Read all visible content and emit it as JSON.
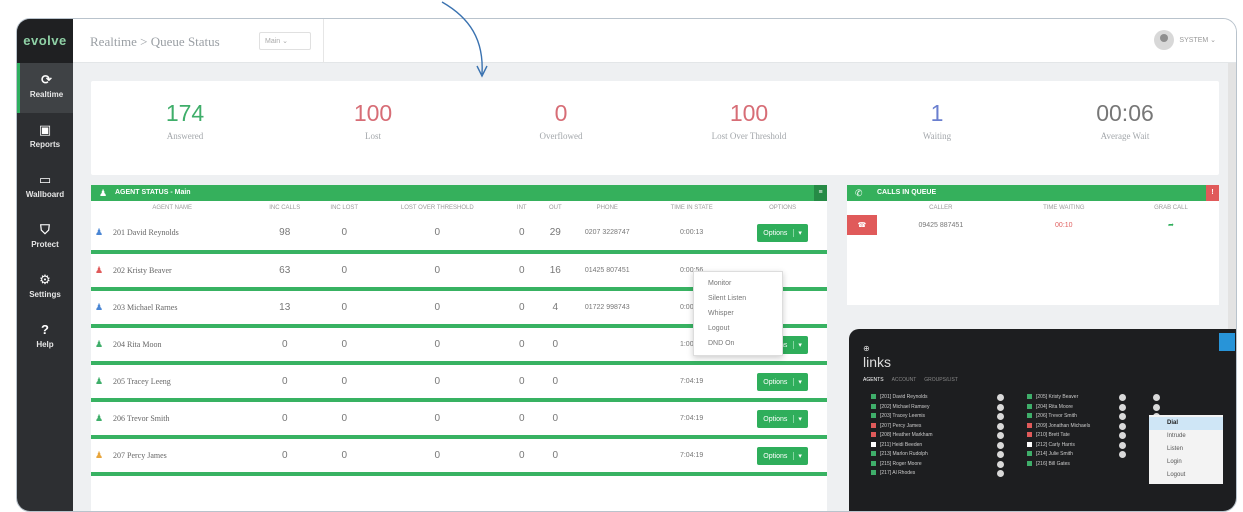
{
  "app": {
    "logo": "evolve",
    "breadcrumb": "Realtime > Queue Status",
    "queue_select": "Main ⌄",
    "user": "SYSTEM ⌄"
  },
  "sidebar": [
    {
      "label": "Realtime",
      "icon": "refresh-icon",
      "glyph": "⟳"
    },
    {
      "label": "Reports",
      "icon": "briefcase-icon",
      "glyph": "▣"
    },
    {
      "label": "Wallboard",
      "icon": "monitor-icon",
      "glyph": "▭"
    },
    {
      "label": "Protect",
      "icon": "shield-icon",
      "glyph": "⛉"
    },
    {
      "label": "Settings",
      "icon": "gears-icon",
      "glyph": "⚙"
    },
    {
      "label": "Help",
      "icon": "help-icon",
      "glyph": "?"
    }
  ],
  "stats": [
    {
      "value": "174",
      "label": "Answered",
      "color": "#3fae6a"
    },
    {
      "value": "100",
      "label": "Lost",
      "color": "#d76d76"
    },
    {
      "value": "0",
      "label": "Overflowed",
      "color": "#d76d76"
    },
    {
      "value": "100",
      "label": "Lost Over Threshold",
      "color": "#d76d76"
    },
    {
      "value": "1",
      "label": "Waiting",
      "color": "#6a7fcf"
    },
    {
      "value": "00:06",
      "label": "Average Wait",
      "color": "#777777"
    }
  ],
  "agents": {
    "title": "AGENT STATUS - Main",
    "columns": [
      "AGENT NAME",
      "INC CALLS",
      "INC LOST",
      "LOST OVER THRESHOLD",
      "INT",
      "OUT",
      "PHONE",
      "TIME IN STATE",
      "OPTIONS"
    ],
    "rows": [
      {
        "name": "201 David Reynolds",
        "inc": "98",
        "lost": "0",
        "lot": "0",
        "int": "0",
        "out": "29",
        "phone": "0207 3228747",
        "time": "0:00:13",
        "color": "#4a86d4",
        "options": true
      },
      {
        "name": "202 Kristy Beaver",
        "inc": "63",
        "lost": "0",
        "lot": "0",
        "int": "0",
        "out": "16",
        "phone": "01425 807451",
        "time": "0:00:56",
        "color": "#e05a5a",
        "options": false
      },
      {
        "name": "203 Michael Rarnes",
        "inc": "13",
        "lost": "0",
        "lot": "0",
        "int": "0",
        "out": "4",
        "phone": "01722 998743",
        "time": "0:00:02",
        "color": "#4a86d4",
        "options": false
      },
      {
        "name": "204 Rita Moon",
        "inc": "0",
        "lost": "0",
        "lot": "0",
        "int": "0",
        "out": "0",
        "phone": "",
        "time": "1:00:39",
        "color": "#3fae6a",
        "options": true
      },
      {
        "name": "205 Tracey Leeng",
        "inc": "0",
        "lost": "0",
        "lot": "0",
        "int": "0",
        "out": "0",
        "phone": "",
        "time": "7:04:19",
        "color": "#3fae6a",
        "options": true
      },
      {
        "name": "206 Trevor Smith",
        "inc": "0",
        "lost": "0",
        "lot": "0",
        "int": "0",
        "out": "0",
        "phone": "",
        "time": "7:04:19",
        "color": "#3fae6a",
        "options": true
      },
      {
        "name": "207 Percy James",
        "inc": "0",
        "lost": "0",
        "lot": "0",
        "int": "0",
        "out": "0",
        "phone": "",
        "time": "7:04:19",
        "color": "#e8a53c",
        "options": true
      }
    ],
    "options_label": "Options",
    "menu": [
      "Monitor",
      "Silent Listen",
      "Whisper",
      "Logout",
      "DND On"
    ]
  },
  "calls": {
    "title": "CALLS IN QUEUE",
    "columns": [
      "CALLER",
      "TIME WAITING",
      "GRAB CALL"
    ],
    "rows": [
      {
        "caller": "09425 887451",
        "waiting": "00:10"
      }
    ]
  },
  "links": {
    "title": "links",
    "tabs": [
      "AGENTS",
      "ACCOUNT",
      "GROUPS/LIST"
    ],
    "col1": [
      {
        "t": "[201] David Reynolds",
        "c": "#3fae6a"
      },
      {
        "t": "[202] Michael Ramsey",
        "c": "#3fae6a"
      },
      {
        "t": "[203] Tracey Leemis",
        "c": "#3fae6a"
      },
      {
        "t": "[207] Percy James",
        "c": "#e05a5a"
      },
      {
        "t": "[208] Heather Markham",
        "c": "#e05a5a"
      },
      {
        "t": "[211] Heidi Beeden",
        "c": "#ffffff"
      },
      {
        "t": "[213] Marlon Rudolph",
        "c": "#3fae6a"
      },
      {
        "t": "[215] Roger Moore",
        "c": "#3fae6a"
      },
      {
        "t": "[217] Al Rhodes",
        "c": "#3fae6a"
      }
    ],
    "col2": [
      {
        "t": "[205] Kristy Beaver",
        "c": "#3fae6a"
      },
      {
        "t": "[204] Rita Moore",
        "c": "#3fae6a"
      },
      {
        "t": "[206] Trevor Smith",
        "c": "#3fae6a"
      },
      {
        "t": "[209] Jonathan Michaels",
        "c": "#e05a5a"
      },
      {
        "t": "[210] Brett Tate",
        "c": "#e05a5a"
      },
      {
        "t": "[212] Carly Harris",
        "c": "#ffffff"
      },
      {
        "t": "[214] Julie Smith",
        "c": "#3fae6a"
      },
      {
        "t": "[216] Bill Gates",
        "c": "#3fae6a"
      }
    ],
    "menu": [
      "Dial",
      "Intrude",
      "Listen",
      "Login",
      "Logout"
    ]
  }
}
